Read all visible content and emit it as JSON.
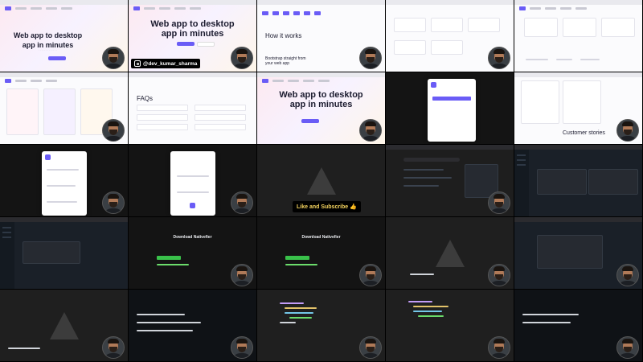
{
  "overlays": {
    "instagram_handle": "@dev_kumar_sharma",
    "subscribe_text": "Like and Subscribe",
    "subscribe_emoji": "👍"
  },
  "headings": {
    "hero_title_line1": "Web app to desktop",
    "hero_title_line2": "app in minutes",
    "how_it_works": "How it works",
    "faqs": "FAQs",
    "customer_stories": "Customer stories",
    "download_title": "Download Nativefier",
    "bootstrap": "Bootstrap straight from your web app"
  },
  "colors": {
    "accent": "#6a5cf6",
    "success": "#39c14a",
    "ide_bg": "#1a2028",
    "editor_bg": "#1f1f1f"
  },
  "tiles": [
    {
      "kind": "hero-landing"
    },
    {
      "kind": "hero-centered"
    },
    {
      "kind": "how-it-works"
    },
    {
      "kind": "notifications"
    },
    {
      "kind": "notifications-grid"
    },
    {
      "kind": "features"
    },
    {
      "kind": "faqs"
    },
    {
      "kind": "hero-centered-2"
    },
    {
      "kind": "dialog-dark"
    },
    {
      "kind": "customer-stories"
    },
    {
      "kind": "modal-steps"
    },
    {
      "kind": "modal-center"
    },
    {
      "kind": "editor-empty"
    },
    {
      "kind": "google-search"
    },
    {
      "kind": "ide-dark"
    },
    {
      "kind": "ide-dark-2"
    },
    {
      "kind": "download-page"
    },
    {
      "kind": "download-page-2"
    },
    {
      "kind": "editor-empty-2"
    },
    {
      "kind": "ide-dark-3"
    },
    {
      "kind": "editor-terminal"
    },
    {
      "kind": "terminal"
    },
    {
      "kind": "code-editor"
    },
    {
      "kind": "code-editor-2"
    },
    {
      "kind": "terminal-2"
    }
  ]
}
